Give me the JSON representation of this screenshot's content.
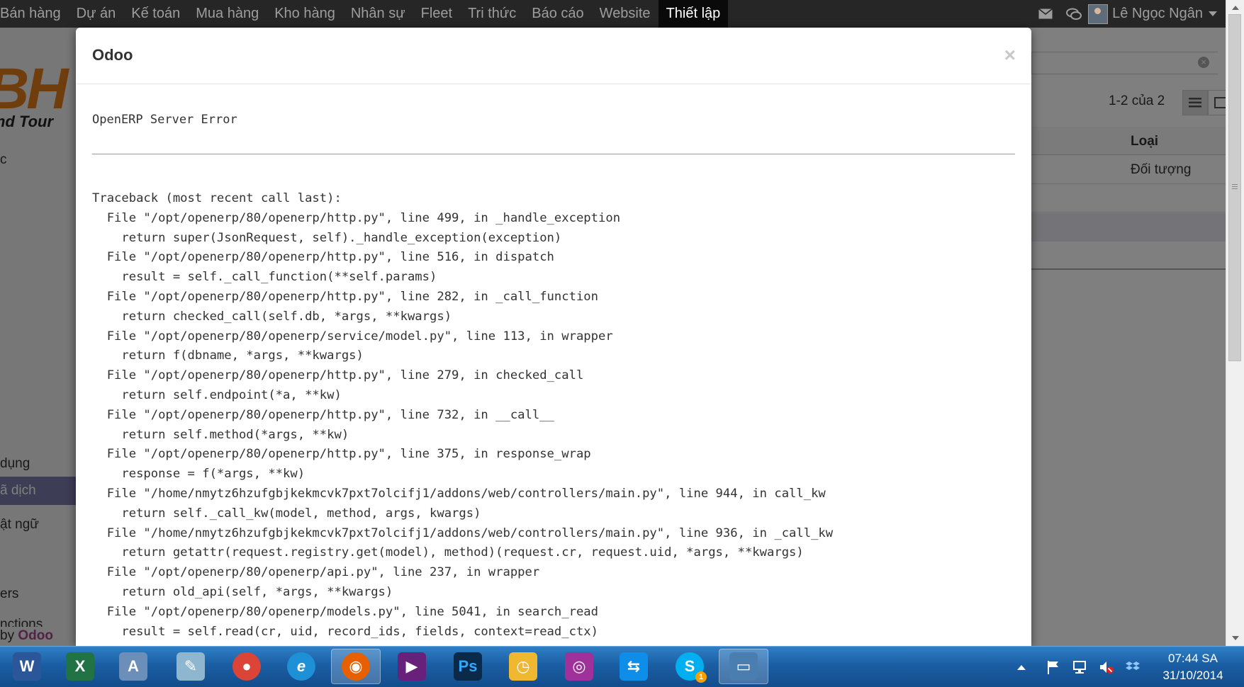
{
  "topbar": {
    "menu": [
      "Bán hàng",
      "Dự án",
      "Kế toán",
      "Mua hàng",
      "Kho hàng",
      "Nhân sự",
      "Fleet",
      "Tri thức",
      "Báo cáo",
      "Website",
      "Thiết lập"
    ],
    "active_index": 10,
    "user_name": "Lê Ngọc Ngân",
    "icons": [
      "mail-icon",
      "chat-icon"
    ]
  },
  "background": {
    "logo_big": "BH",
    "logo_small": "nd Tour",
    "sidebar_items": [
      "c",
      "dụng",
      "ã dịch",
      "ật ngữ",
      "ers",
      "nctions"
    ],
    "selected_index": 2,
    "powered_prefix": "by",
    "powered_brand": "Odoo",
    "pager": "1-2 của 2",
    "column_header": "Loại",
    "row_value": "Đối tượng"
  },
  "modal": {
    "title": "Odoo",
    "close_label": "×",
    "error_title": "OpenERP Server Error",
    "traceback": [
      "Traceback (most recent call last):",
      "  File \"/opt/openerp/80/openerp/http.py\", line 499, in _handle_exception",
      "    return super(JsonRequest, self)._handle_exception(exception)",
      "  File \"/opt/openerp/80/openerp/http.py\", line 516, in dispatch",
      "    result = self._call_function(**self.params)",
      "  File \"/opt/openerp/80/openerp/http.py\", line 282, in _call_function",
      "    return checked_call(self.db, *args, **kwargs)",
      "  File \"/opt/openerp/80/openerp/service/model.py\", line 113, in wrapper",
      "    return f(dbname, *args, **kwargs)",
      "  File \"/opt/openerp/80/openerp/http.py\", line 279, in checked_call",
      "    return self.endpoint(*a, **kw)",
      "  File \"/opt/openerp/80/openerp/http.py\", line 732, in __call__",
      "    return self.method(*args, **kw)",
      "  File \"/opt/openerp/80/openerp/http.py\", line 375, in response_wrap",
      "    response = f(*args, **kw)",
      "  File \"/home/nmytz6hzufgbjkekmcvk7pxt7olcifj1/addons/web/controllers/main.py\", line 944, in call_kw",
      "    return self._call_kw(model, method, args, kwargs)",
      "  File \"/home/nmytz6hzufgbjkekmcvk7pxt7olcifj1/addons/web/controllers/main.py\", line 936, in _call_kw",
      "    return getattr(request.registry.get(model), method)(request.cr, request.uid, *args, **kwargs)",
      "  File \"/opt/openerp/80/openerp/api.py\", line 237, in wrapper",
      "    return old_api(self, *args, **kwargs)",
      "  File \"/opt/openerp/80/openerp/models.py\", line 5041, in search_read",
      "    result = self.read(cr, uid, record_ids, fields, context=read_ctx)"
    ]
  },
  "taskbar": {
    "apps": [
      {
        "name": "word-icon",
        "glyph": "W",
        "color": "#2b579a"
      },
      {
        "name": "excel-icon",
        "glyph": "X",
        "color": "#217346"
      },
      {
        "name": "address-book-icon",
        "glyph": "A",
        "color": "#6b8fb8"
      },
      {
        "name": "notepad-icon",
        "glyph": "✎",
        "color": "#8fb6cf"
      },
      {
        "name": "chrome-icon",
        "glyph": "●",
        "color": "#db4437"
      },
      {
        "name": "internet-explorer-icon",
        "glyph": "e",
        "color": "#1e90d6"
      },
      {
        "name": "firefox-icon",
        "glyph": "◉",
        "color": "#e66000"
      },
      {
        "name": "visual-studio-icon",
        "glyph": "▶",
        "color": "#68217a"
      },
      {
        "name": "photoshop-icon",
        "glyph": "Ps",
        "color": "#0b2a4a"
      },
      {
        "name": "outlook-calendar-icon",
        "glyph": "◷",
        "color": "#f0b830"
      },
      {
        "name": "screen-recorder-icon",
        "glyph": "◎",
        "color": "#a0309a"
      },
      {
        "name": "teamviewer-icon",
        "glyph": "⇆",
        "color": "#0e8ee9"
      },
      {
        "name": "skype-icon",
        "glyph": "S",
        "color": "#00aff0"
      },
      {
        "name": "photo-viewer-icon",
        "glyph": "▭",
        "color": "#4a7eb0"
      }
    ],
    "active_index": 6,
    "skype_badge": "1",
    "tray_icons": [
      "tray-expand-icon",
      "flag-icon",
      "network-icon",
      "volume-muted-icon",
      "dropbox-icon"
    ],
    "time": "07:44 SA",
    "date": "31/10/2014"
  }
}
